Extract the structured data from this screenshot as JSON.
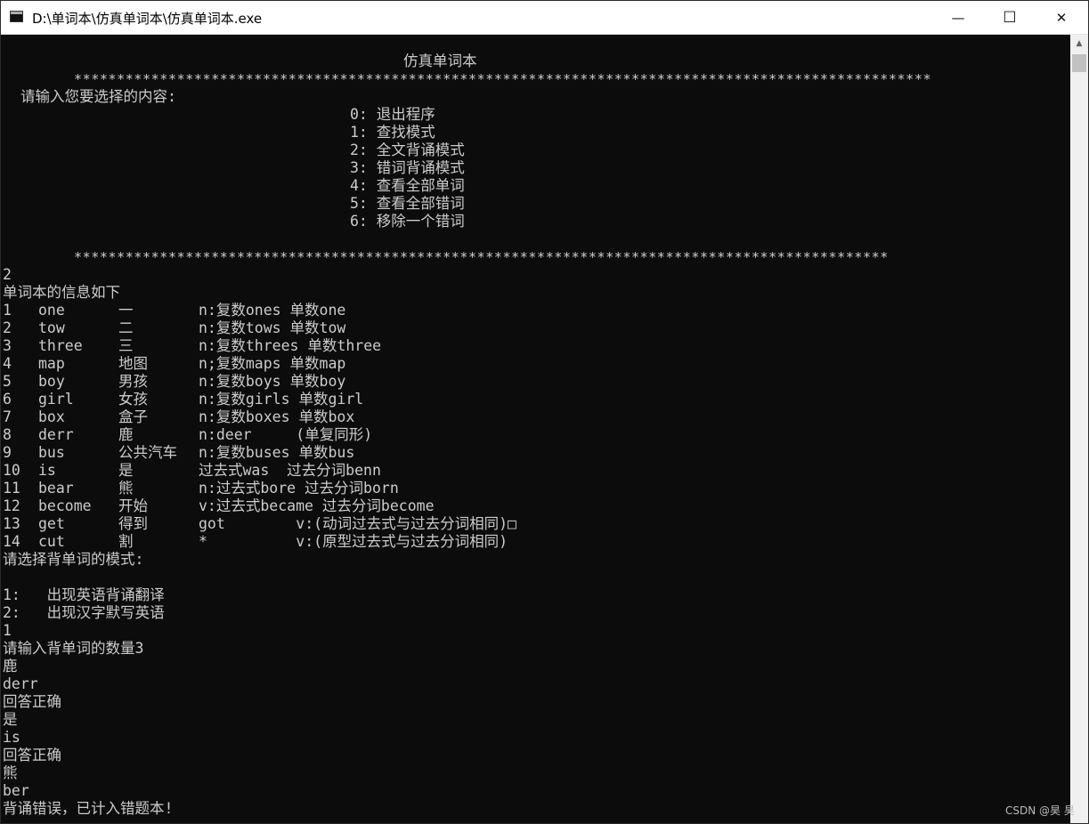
{
  "window": {
    "title": "D:\\单词本\\仿真单词本\\仿真单词本.exe",
    "minimize_glyph": "—",
    "maximize_glyph": "☐",
    "close_glyph": "✕"
  },
  "console": {
    "title": "仿真单词本",
    "separator1": "****************************************************************************************************",
    "prompt": "请输入您要选择的内容:",
    "menu": [
      "0: 退出程序",
      "1: 查找模式",
      "2: 全文背诵模式",
      "3: 错词背诵模式",
      "4: 查看全部单词",
      "5: 查看全部错词",
      "6: 移除一个错词"
    ],
    "separator2": "***********************************************************************************************",
    "input_choice": "2",
    "info_header": "单词本的信息如下",
    "words": [
      {
        "num": "1",
        "en": "one",
        "cn": "一",
        "note": "n:复数ones 单数one"
      },
      {
        "num": "2",
        "en": "tow",
        "cn": "二",
        "note": "n:复数tows 单数tow"
      },
      {
        "num": "3",
        "en": "three",
        "cn": "三",
        "note": "n:复数threes 单数three"
      },
      {
        "num": "4",
        "en": "map",
        "cn": "地图",
        "note": "n;复数maps 单数map"
      },
      {
        "num": "5",
        "en": "boy",
        "cn": "男孩",
        "note": "n:复数boys 单数boy"
      },
      {
        "num": "6",
        "en": "girl",
        "cn": "女孩",
        "note": "n:复数girls 单数girl"
      },
      {
        "num": "7",
        "en": "box",
        "cn": "盒子",
        "note": "n:复数boxes 单数box"
      },
      {
        "num": "8",
        "en": "derr",
        "cn": "鹿",
        "note": "n:deer     (单复同形)"
      },
      {
        "num": "9",
        "en": "bus",
        "cn": "公共汽车",
        "note": "n:复数buses 单数bus"
      },
      {
        "num": "10",
        "en": "is",
        "cn": "是",
        "note": "过去式was  过去分词benn"
      },
      {
        "num": "11",
        "en": "bear",
        "cn": "熊",
        "note": "n:过去式bore 过去分词born"
      },
      {
        "num": "12",
        "en": "become",
        "cn": "开始",
        "note": "v:过去式became 过去分词become"
      },
      {
        "num": "13",
        "en": "get",
        "cn": "得到",
        "note": "got        v:(动词过去式与过去分词相同)□"
      },
      {
        "num": "14",
        "en": "cut",
        "cn": "割",
        "note": "*          v:(原型过去式与过去分词相同)"
      }
    ],
    "mode_prompt": "请选择背单词的模式:",
    "mode_options": [
      "1:   出现英语背诵翻译",
      "2:   出现汉字默写英语"
    ],
    "mode_input": "1",
    "count_prompt": "请输入背单词的数量3",
    "session": [
      "鹿",
      "derr",
      "回答正确",
      "是",
      "is",
      "回答正确",
      "熊",
      "ber",
      "背诵错误，已计入错题本!"
    ]
  },
  "watermark": "CSDN @昊 昊"
}
